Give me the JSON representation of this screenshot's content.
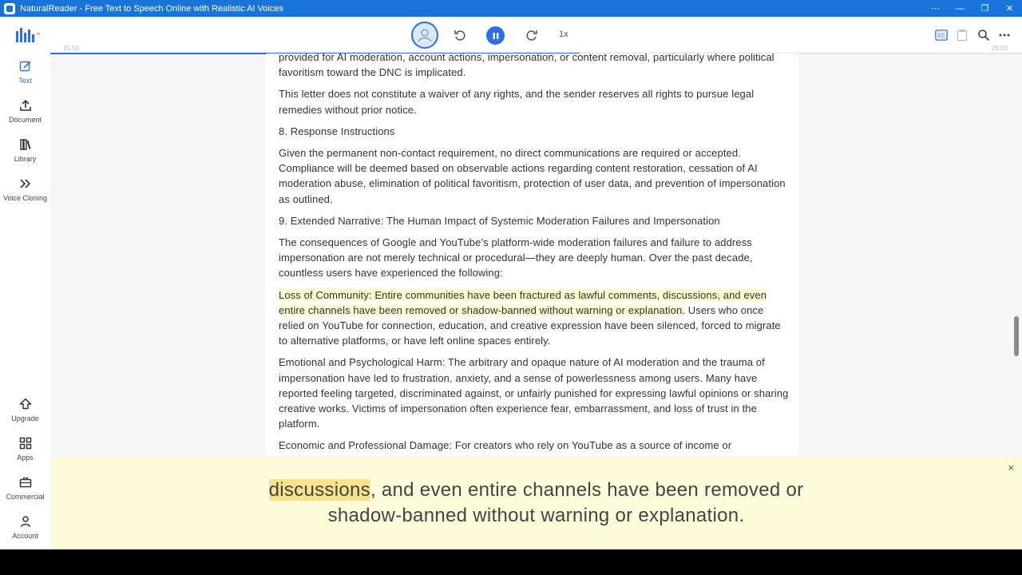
{
  "window": {
    "title": "NaturalReader - Free Text to Speech Online with Realistic AI Voices",
    "controls": [
      "⋯",
      "—",
      "❐",
      "✕"
    ]
  },
  "sidebar": {
    "top_items": [
      {
        "label": "Text",
        "icon": "edit-icon",
        "active": true
      },
      {
        "label": "Document",
        "icon": "upload-icon"
      },
      {
        "label": "Library",
        "icon": "library-icon"
      },
      {
        "label": "Voice Cloning",
        "icon": "voice-clone-icon"
      }
    ],
    "bottom_items": [
      {
        "label": "Upgrade",
        "icon": "upgrade-icon"
      },
      {
        "label": "Apps",
        "icon": "apps-grid-icon"
      },
      {
        "label": "Commercial",
        "icon": "briefcase-icon"
      },
      {
        "label": "Account",
        "icon": "account-icon"
      }
    ]
  },
  "player": {
    "speed": "1x",
    "elapsed": "15:50",
    "total": "29:03",
    "progress": 0.545,
    "accent": "#2d6ee8"
  },
  "document": {
    "paragraphs": [
      "provided for AI moderation, account actions, impersonation, or content removal, particularly where political favoritism toward the DNC is implicated.",
      "This letter does not constitute a waiver of any rights, and the sender reserves all rights to pursue legal remedies without prior notice.",
      "8. Response Instructions",
      "Given the permanent non-contact requirement, no direct communications are required or accepted. Compliance will be deemed based on observable actions regarding content restoration, cessation of AI moderation abuse, elimination of political favoritism, protection of user data, and prevention of impersonation as outlined.",
      "9. Extended Narrative: The Human Impact of Systemic Moderation Failures and Impersonation",
      "The consequences of Google and YouTube’s platform-wide moderation failures and failure to address impersonation are not merely technical or procedural—they are deeply human. Over the past decade, countless users have experienced the following:"
    ],
    "highlight_paragraph": {
      "highlighted": "Loss of Community: Entire communities have been fractured as lawful comments, discussions, and even entire channels have been removed or shadow-banned without warning or explanation.",
      "rest": " Users who once relied on YouTube for connection, education, and creative expression have been silenced, forced to migrate to alternative platforms, or have left online spaces entirely."
    },
    "paragraphs_after": [
      "Emotional and Psychological Harm: The arbitrary and opaque nature of AI moderation and the trauma of impersonation have led to frustration, anxiety, and a sense of powerlessness among users. Many have reported feeling targeted, discriminated against, or unfairly punished for expressing lawful opinions or sharing creative works. Victims of impersonation often experience fear, embarrassment, and loss of trust in the platform.",
      "Economic and Professional Damage:  For creators who rely on YouTube as a source of income or"
    ]
  },
  "caption": {
    "current_word": "discussions",
    "rest": ", and even entire channels have been removed or shadow-banned without warning or explanation.",
    "close": "×"
  }
}
